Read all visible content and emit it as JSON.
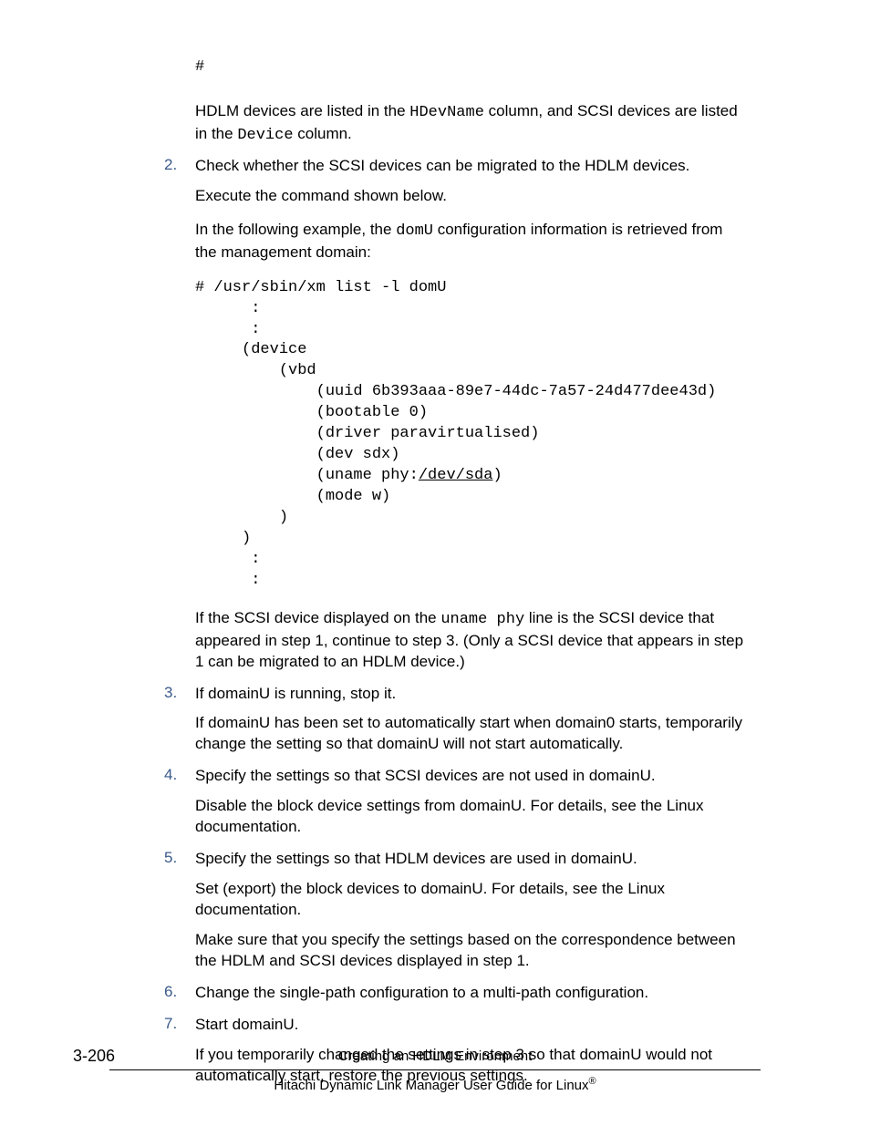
{
  "hash": "#",
  "para_hdlm_pre": "HDLM devices are listed in the ",
  "code_hdevname": "HDevName",
  "para_hdlm_mid": " column, and SCSI devices are listed in the ",
  "code_device": "Device",
  "para_hdlm_post": " column.",
  "steps": {
    "s2_num": "2",
    "s2_p1": "Check whether the SCSI devices can be migrated to the HDLM devices.",
    "s2_p2": "Execute the command shown below.",
    "s2_p3_pre": "In the following example, the ",
    "s2_code_domU": "domU",
    "s2_p3_post": " configuration information is retrieved from the management domain:",
    "s2_code_l1": "# /usr/sbin/xm list -l domU",
    "s2_code_l2": "      :",
    "s2_code_l3": "      :",
    "s2_code_l4": "     (device",
    "s2_code_l5": "         (vbd",
    "s2_code_l6": "             (uuid 6b393aaa-89e7-44dc-7a57-24d477dee43d)",
    "s2_code_l7": "             (bootable 0)",
    "s2_code_l8": "             (driver paravirtualised)",
    "s2_code_l9": "             (dev sdx)",
    "s2_code_l10a": "             (uname phy:",
    "s2_code_l10b": "/dev/sda",
    "s2_code_l10c": ")",
    "s2_code_l11": "             (mode w)",
    "s2_code_l12": "         )",
    "s2_code_l13": "     )",
    "s2_code_l14": "      :",
    "s2_code_l15": "      :",
    "s2_p4_pre": "If the SCSI device displayed on the ",
    "s2_code_uname": "uname phy",
    "s2_p4_post": " line is the SCSI device that appeared in step 1, continue to step 3. (Only a SCSI device that appears in step 1 can be migrated to an HDLM device.)",
    "s3_num": "3",
    "s3_p1": "If domainU is running, stop it.",
    "s3_p2": "If domainU has been set to automatically start when domain0 starts, temporarily change the setting so that domainU will not start automatically.",
    "s4_num": "4",
    "s4_p1": "Specify the settings so that SCSI devices are not used in domainU.",
    "s4_p2": "Disable the block device settings from domainU. For details, see the Linux documentation.",
    "s5_num": "5",
    "s5_p1": "Specify the settings so that HDLM devices are used in domainU.",
    "s5_p2": "Set (export) the block devices to domainU. For details, see the Linux documentation.",
    "s5_p3": "Make sure that you specify the settings based on the correspondence between the HDLM and SCSI devices displayed in step 1.",
    "s6_num": "6",
    "s6_p1": "Change the single-path configuration to a multi-path configuration.",
    "s7_num": "7",
    "s7_p1": "Start domainU.",
    "s7_p2": "If you temporarily changed the settings in step 3 so that domainU would not automatically start, restore the previous settings."
  },
  "footer": {
    "section": "Creating an HDLM Environment",
    "guide_pre": "Hitachi Dynamic Link Manager User Guide for Linux",
    "reg": "®",
    "page": "3-206"
  }
}
